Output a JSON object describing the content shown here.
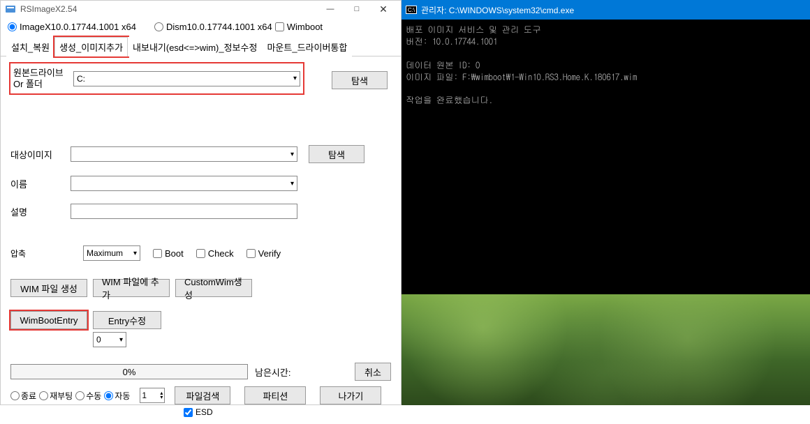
{
  "app": {
    "title": "RSImageX2.54",
    "win_min": "—",
    "win_max": "□",
    "win_close": "✕"
  },
  "radios": {
    "imagex": "ImageX10.0.17744.1001 x64",
    "dism": "Dism10.0.17744.1001 x64",
    "wimboot": "Wimboot"
  },
  "tabs": {
    "t1": "설치_복원",
    "t2": "생성_이미지추가",
    "t3": "내보내기(esd<=>wim)_정보수정",
    "t4": "마운트_드라이버통합"
  },
  "form": {
    "src_label": "원본드라이브\nOr 폴더",
    "src_value": "C:",
    "browse": "탐색",
    "target_label": "대상이미지",
    "name_label": "이름",
    "desc_label": "설명",
    "compress_label": "압축",
    "compress_value": "Maximum",
    "boot": "Boot",
    "check": "Check",
    "verify": "Verify"
  },
  "buttons": {
    "wim_create": "WIM 파일 생성",
    "wim_append": "WIM 파일에 추가",
    "custom_wim": "CustomWim생성",
    "wimboot_entry": "WimBootEntry",
    "entry_edit": "Entry수정",
    "small_combo": "0",
    "cancel": "취소",
    "file_search": "파일검색",
    "partition": "파티션",
    "exit": "나가기"
  },
  "progress": {
    "pct": "0%",
    "remain": "남은시간:"
  },
  "bottom_radios": {
    "r1": "종료",
    "r2": "재부팅",
    "r3": "수동",
    "r4": "자동",
    "spinner": "1",
    "esd": "ESD"
  },
  "cmd": {
    "title": "관리자: C:\\WINDOWS\\system32\\cmd.exe",
    "icon": "C:\\",
    "line1": "배포 이미지 서비스 및 관리 도구",
    "line2": "버전: 10.0.17744.1001",
    "line3": "데이터 원본 ID: 0",
    "line4": "이미지 파일: F:\\wimboot\\1-Win10.RS3.Home.K.180617.wim",
    "line5": "작업을 완료했습니다."
  }
}
